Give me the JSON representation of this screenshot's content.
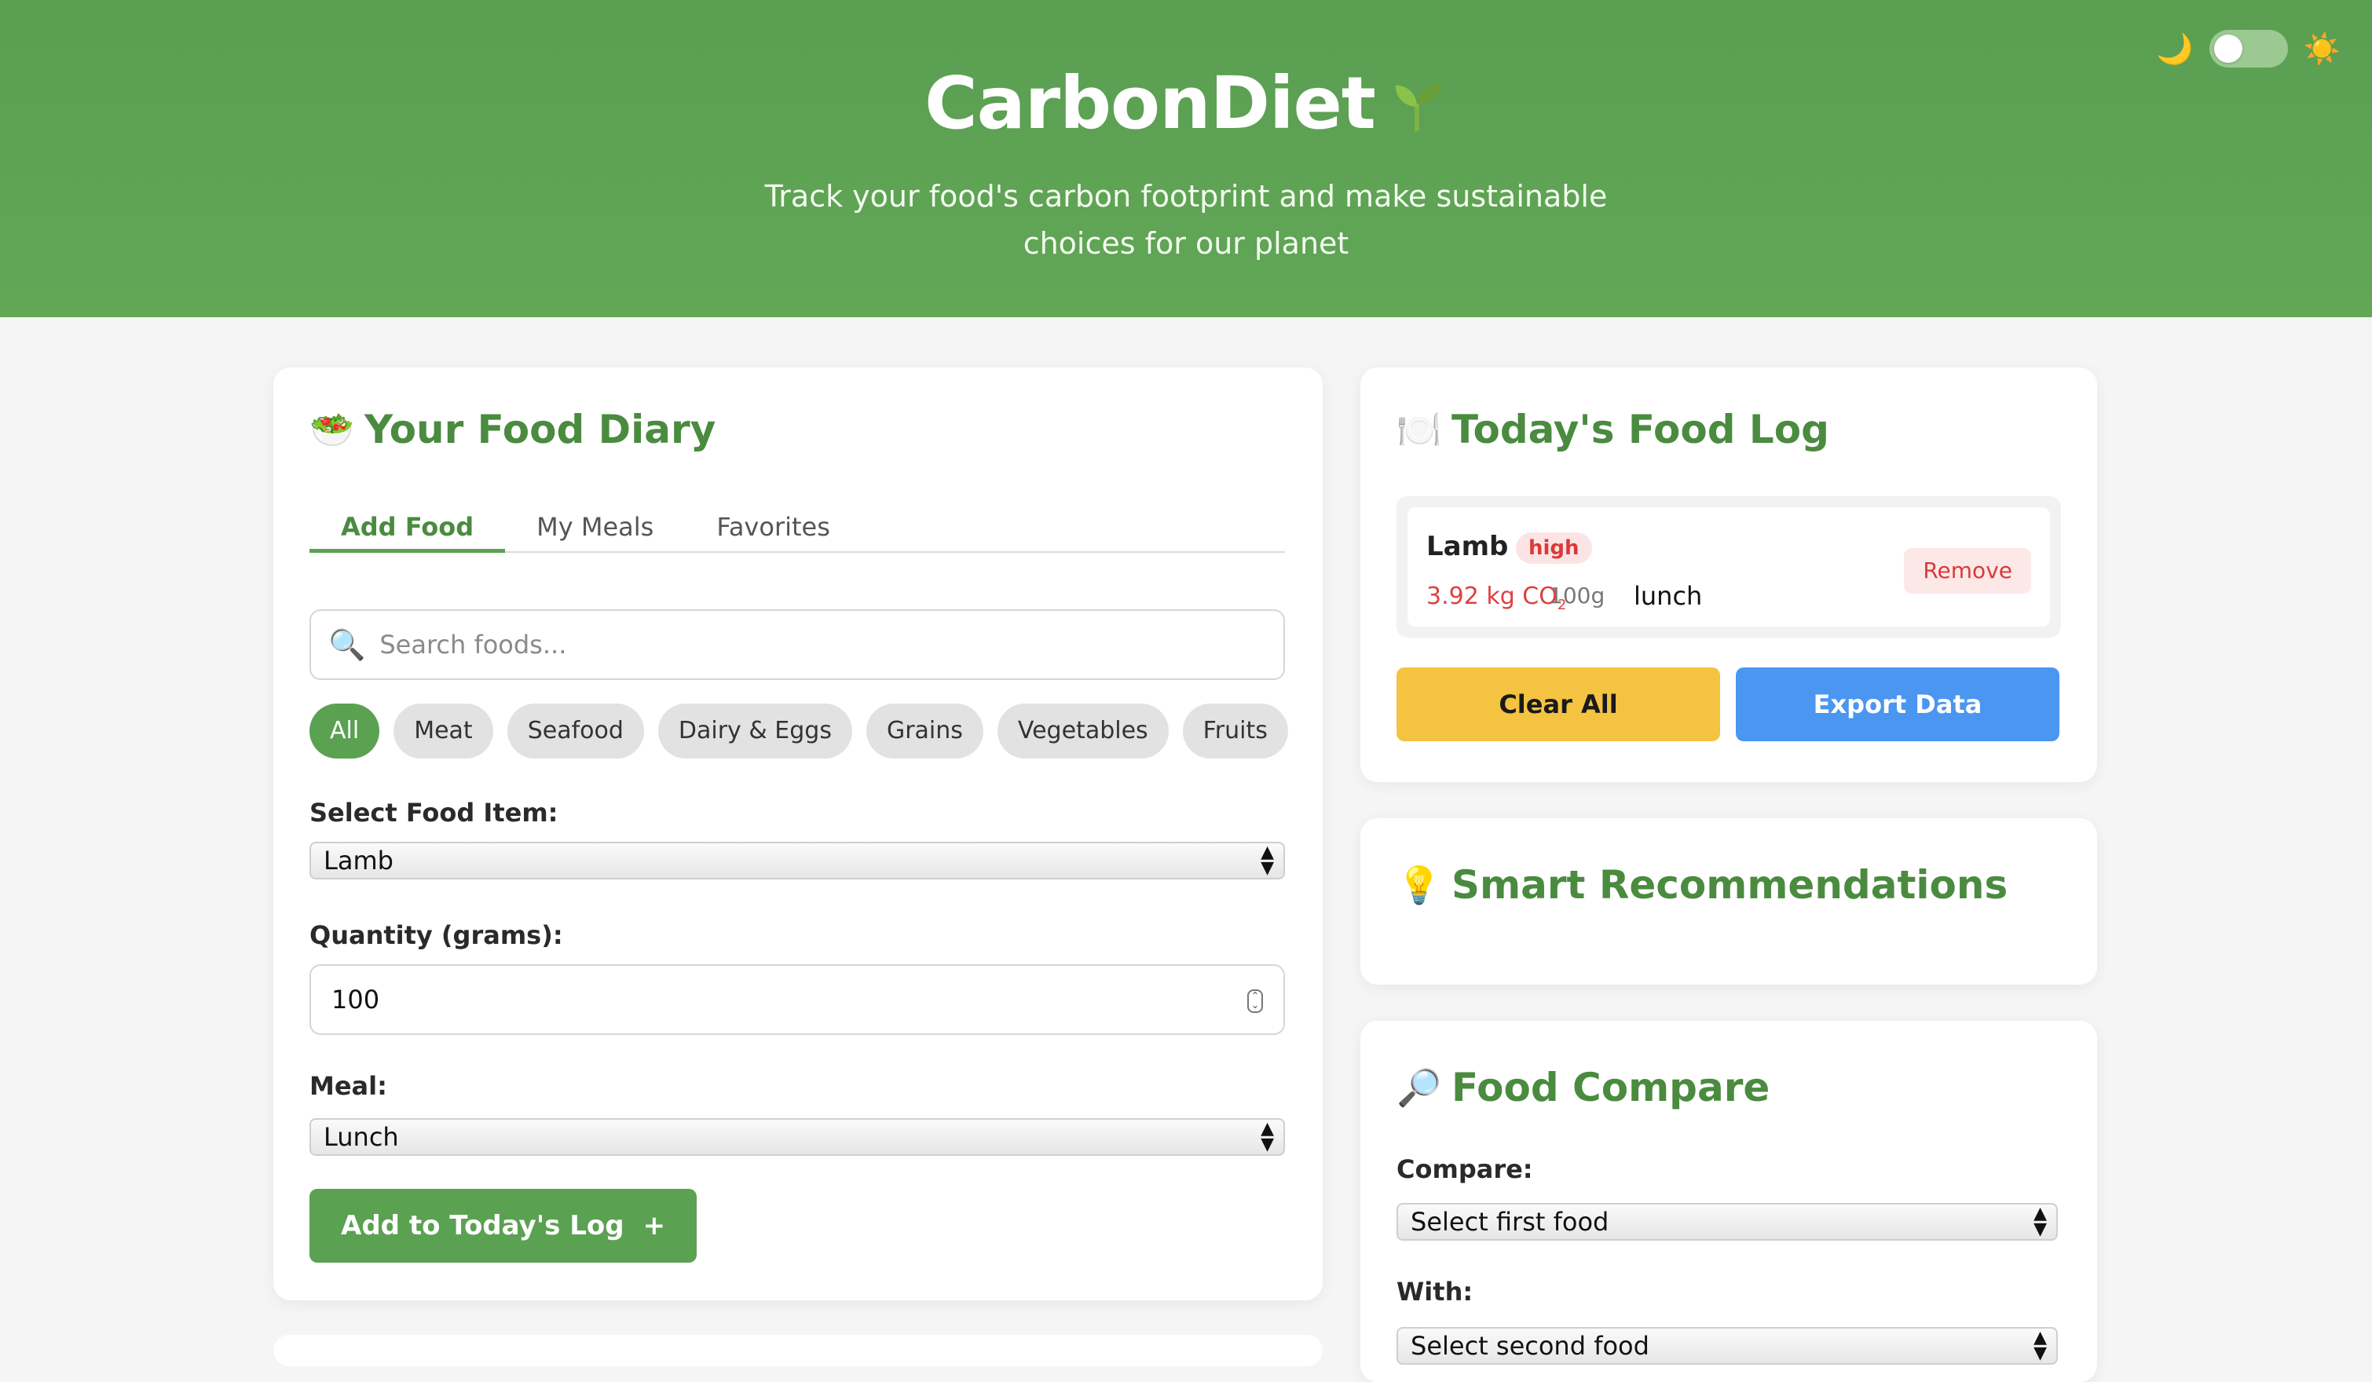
{
  "header": {
    "title": "CarbonDiet",
    "title_icon": "seedling-icon",
    "tagline": "Track your food's carbon footprint and make sustainable choices for our planet",
    "theme_toggle": {
      "moon_icon": "🌙",
      "sun_icon": "☀️"
    }
  },
  "diary": {
    "icon": "🥗",
    "title": "Your Food Diary",
    "tabs": [
      {
        "label": "Add Food"
      },
      {
        "label": "My Meals"
      },
      {
        "label": "Favorites"
      }
    ],
    "search": {
      "icon": "🔍",
      "placeholder": "Search foods...",
      "value": ""
    },
    "categories": [
      {
        "label": "All"
      },
      {
        "label": "Meat"
      },
      {
        "label": "Seafood"
      },
      {
        "label": "Dairy & Eggs"
      },
      {
        "label": "Grains"
      },
      {
        "label": "Vegetables"
      },
      {
        "label": "Fruits"
      }
    ],
    "food_label": "Select Food Item:",
    "food_value": "Lamb",
    "quantity_label": "Quantity (grams):",
    "quantity_value": "100",
    "meal_label": "Meal:",
    "meal_value": "Lunch",
    "add_button": "Add to Today's Log",
    "add_icon": "+"
  },
  "log": {
    "icon": "🍽️",
    "title": "Today's Food Log",
    "items": [
      {
        "name": "Lamb",
        "badge": "high",
        "co2_value": "3.92 kg CO",
        "co2_sub": "2",
        "qty": "100g",
        "meal": "lunch",
        "remove": "Remove"
      }
    ],
    "clear_button": "Clear All",
    "export_button": "Export Data"
  },
  "recommendations": {
    "icon": "💡",
    "title": "Smart Recommendations"
  },
  "compare": {
    "icon": "🔎",
    "title": "Food Compare",
    "compare_label": "Compare:",
    "first_placeholder": "Select first food",
    "with_label": "With:",
    "second_placeholder": "Select second food"
  },
  "colors": {
    "brand_green": "#5ba152",
    "high_red": "#d93a3a",
    "clear_yellow": "#f4c342",
    "export_blue": "#4a96f0"
  }
}
